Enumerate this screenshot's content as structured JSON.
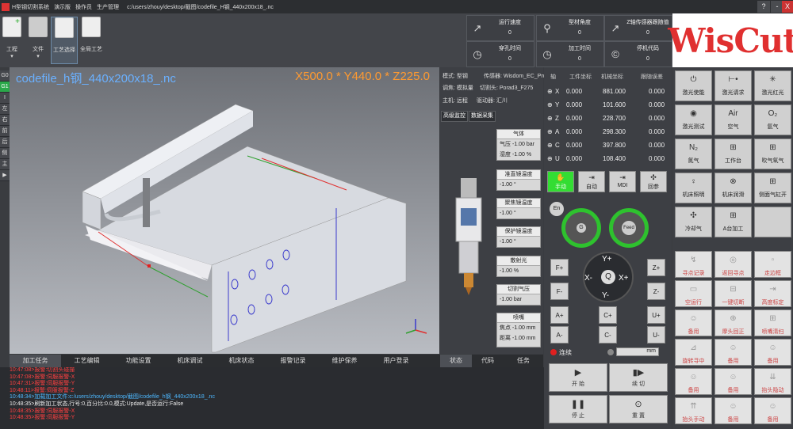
{
  "titlebar": {
    "app": "H型钢切割系统",
    "menu": [
      "演示版",
      "操作员",
      "生产管理"
    ],
    "path": "c:/users/zhouy/desktop/截图/codefile_H钢_440x200x18_.nc",
    "help": "?",
    "min": "-",
    "close": "X"
  },
  "toolbar": {
    "items": [
      {
        "label": "工程",
        "icon": "new-file-icon"
      },
      {
        "label": "文件",
        "icon": "folder-icon"
      },
      {
        "label": "工艺选择",
        "icon": "process-select-icon"
      },
      {
        "label": "全局工艺",
        "icon": "global-process-icon"
      }
    ]
  },
  "stats": [
    {
      "label": "运行速度",
      "value": "0",
      "icon": "speed-icon"
    },
    {
      "label": "型材角度",
      "value": "0",
      "icon": "angle-icon"
    },
    {
      "label": "Z轴传感器跟随值",
      "value": "0",
      "icon": "z-sensor-icon"
    },
    {
      "label": "穿孔时间",
      "value": "0",
      "icon": "clock-icon"
    },
    {
      "label": "加工时间",
      "value": "0",
      "icon": "clock-icon"
    },
    {
      "label": "停机代码",
      "value": "0",
      "icon": "copyright-icon"
    }
  ],
  "brand": "WisCut",
  "lefttabs": [
    "G0",
    "G1",
    "I",
    "左",
    "右",
    "前",
    "后",
    "侧",
    "主",
    "▶"
  ],
  "viewport": {
    "filename": "codefile_h钢_440x200x18_.nc",
    "coords": "X500.0 * Y440.0 * Z225.0"
  },
  "mid": {
    "info": [
      "模式: 型钢",
      "传感器: Wisdom_EC_Pro",
      "调焦: 模拟量",
      "切割头: Porad3_F275",
      "主机: 远程",
      "驱动器: 汇川"
    ],
    "buttons": [
      "高级监控",
      "数据采集"
    ],
    "params": [
      {
        "title": "气体",
        "values": [
          "气压 -1.00 bar",
          "湿度 -1.00 %"
        ]
      },
      {
        "title": "准直镜温度",
        "values": [
          "-1.00 °"
        ]
      },
      {
        "title": "聚焦镜温度",
        "values": [
          "-1.00 °"
        ]
      },
      {
        "title": "保护镜温度",
        "values": [
          "-1.00 °"
        ]
      },
      {
        "title": "散射光",
        "values": [
          "-1.00 %"
        ]
      },
      {
        "title": "切割气压",
        "values": [
          "-1.00 bar"
        ]
      },
      {
        "title": "喷嘴",
        "values": [
          "焦点 -1.00 mm",
          "距离 -1.00 mm"
        ]
      }
    ]
  },
  "axes": {
    "headers": [
      "轴",
      "工件坐标",
      "机械坐标",
      "跟随误差"
    ],
    "rows": [
      {
        "axis": "X",
        "work": "0.000",
        "mach": "881.000",
        "err": "0.000"
      },
      {
        "axis": "Y",
        "work": "0.000",
        "mach": "101.600",
        "err": "0.000"
      },
      {
        "axis": "Z",
        "work": "0.000",
        "mach": "228.700",
        "err": "0.000"
      },
      {
        "axis": "A",
        "work": "0.000",
        "mach": "298.300",
        "err": "0.000"
      },
      {
        "axis": "C",
        "work": "0.000",
        "mach": "397.800",
        "err": "0.000"
      },
      {
        "axis": "U",
        "work": "0.000",
        "mach": "108.400",
        "err": "0.000"
      }
    ]
  },
  "modes": [
    "手动",
    "自动",
    "MDI",
    "回参"
  ],
  "gauges": {
    "en": "En",
    "g": "G",
    "feed": "Feed",
    "scale": [
      "100",
      "120",
      "150"
    ]
  },
  "jog": {
    "yplus": "Y+",
    "yminus": "Y-",
    "xminus": "X-",
    "xplus": "X+",
    "q": "Q",
    "fplus": "F+",
    "fminus": "F-",
    "zplus": "Z+",
    "zminus": "Z-",
    "aplus": "A+",
    "aminus": "A-",
    "cplus": "C+",
    "cminus": "C-",
    "uplus": "U+",
    "uminus": "U-"
  },
  "continuous": {
    "label": "连续",
    "unit": "mm"
  },
  "controls": [
    {
      "label": "开 始",
      "icon": "play-icon"
    },
    {
      "label": "续 切",
      "icon": "resume-icon"
    },
    {
      "label": "停 止",
      "icon": "pause-icon"
    },
    {
      "label": "重 置",
      "icon": "reset-icon"
    }
  ],
  "funcs": [
    "激光使能",
    "激光请求",
    "激光红光",
    "激光测试",
    "空气",
    "氩气",
    "氮气",
    "工作台",
    "吹气氧气",
    "机床照明",
    "机床润滑",
    "侧面气缸开",
    "冷却气",
    "A台加工",
    "",
    "寻点记录",
    "返回寻点",
    "走边框",
    "空运行",
    "一键切断",
    "高度标定",
    "备用",
    "摩头回正",
    "喷嘴清扫",
    "旋转寻中",
    "备用",
    "备用",
    "备用",
    "备用",
    "抬头隐动",
    "抬头手动",
    "备用",
    "备用"
  ],
  "funcicons": {
    "air": "Air",
    "o2": "O₂",
    "n2": "N₂"
  },
  "bottomtabs": [
    "加工任务",
    "工艺编辑",
    "功能设置",
    "机床调试",
    "机床状态",
    "报警记录",
    "维护保养",
    "用户登录",
    "状态",
    "代码",
    "任务"
  ],
  "log": [
    {
      "text": "10:47:08>报警:切割头碰撞",
      "color": "#ff4040"
    },
    {
      "text": "10:47:08>报警:伺服报警-X",
      "color": "#ff4040"
    },
    {
      "text": "10:47:31>报警:伺服报警-Y",
      "color": "#ff4040"
    },
    {
      "text": "10:48:11>报警:伺服报警-Z",
      "color": "#ff4040"
    },
    {
      "text": "10:48:34>加载加工文件:c:/users/zhouy/desktop/截图/codefile_h钢_440x200x18_.nc",
      "color": "#4db8ff"
    },
    {
      "text": "10:48:35>刷新加工状态,行号:0,百分比:0.0,模式:Update,是否运行:False",
      "color": "#e8e8e8"
    },
    {
      "text": "10:48:35>报警:伺服报警-X",
      "color": "#ff4040"
    },
    {
      "text": "10:48:35>报警:伺服报警-Y",
      "color": "#ff4040"
    }
  ]
}
